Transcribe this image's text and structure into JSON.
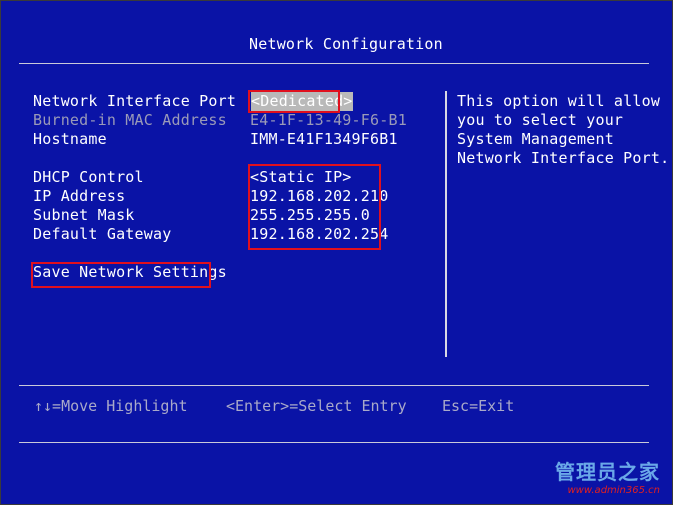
{
  "title": "Network Configuration",
  "fields": [
    {
      "label": "Network Interface Port",
      "value": "<Dedicated>"
    },
    {
      "label": "Burned-in MAC Address",
      "value": "E4-1F-13-49-F6-B1"
    },
    {
      "label": "Hostname",
      "value": "IMM-E41F1349F6B1"
    },
    {
      "label": "DHCP Control",
      "value": "<Static IP>"
    },
    {
      "label": "IP Address",
      "value": "192.168.202.210"
    },
    {
      "label": "Subnet Mask",
      "value": "255.255.255.0"
    },
    {
      "label": "Default Gateway",
      "value": "192.168.202.254"
    }
  ],
  "save_label": "Save Network Settings",
  "help": [
    "This option will allow",
    "you to select your",
    "System Management",
    "Network Interface Port."
  ],
  "footer": {
    "move": "↑↓=Move Highlight",
    "select": "<Enter>=Select Entry",
    "exit": "Esc=Exit"
  },
  "watermark": {
    "title": "管理员之家",
    "url": "www.admin365.cn"
  },
  "colors": {
    "background": "#0a13a6",
    "highlight": "#b9b9b9",
    "annotation_box": "#e0101e"
  }
}
